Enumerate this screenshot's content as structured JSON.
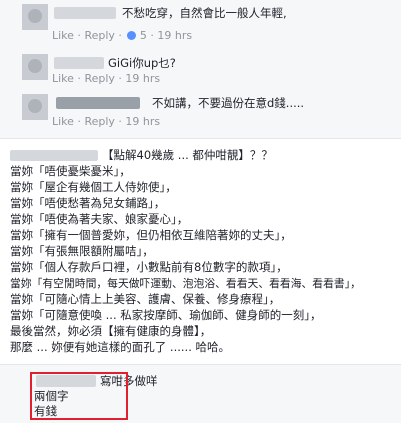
{
  "comments": [
    {
      "text": "不愁吃穿，自然會比一般人年輕,",
      "like": "Like",
      "reply": "Reply",
      "time": "5 · 19 hrs"
    },
    {
      "text": "GiGi你up乜?",
      "like": "Like",
      "reply": "Reply",
      "time": "19 hrs"
    },
    {
      "text": "不如講，不要過份在意d錢.....",
      "like": "Like",
      "reply": "Reply",
      "time": "19 hrs"
    }
  ],
  "post": {
    "lines": [
      "【點解40幾歲 ... 都仲咁靚】？？",
      "當妳「唔使憂柴憂米」，",
      "當妳「屋企有幾個工人侍妳使」，",
      "當妳「唔使愁著為兒女鋪路」，",
      "當妳「唔使為著夫家、娘家憂心」，",
      "當妳「擁有一個普愛妳，但仍相依互維陪著妳的丈夫」，",
      "當妳「有張無限額附屬咭」，",
      "當妳「個人存款戶口裡，小數點前有8位數字的款項」，",
      "當妳「有空閒時間，每天做吓運動、泡泡浴、看看天、看看海、看看書」，",
      "當妳「可隨心情上上美容、護膚、保養、修身療程」，",
      "當妳「可隨意使喚 ... 私家按摩師、瑜伽師、健身師的一刻」，",
      "最後當然，妳必須【擁有健康的身體】，",
      "那麼 ... 妳便有她這樣的面孔了 ...... 哈哈。"
    ]
  },
  "reply_box": {
    "line1": "寫咁多做咩",
    "line2": "兩個字",
    "line3": "有錢"
  },
  "colors": {
    "highlight_border": "#e0202e",
    "meta_text": "#90949c"
  }
}
